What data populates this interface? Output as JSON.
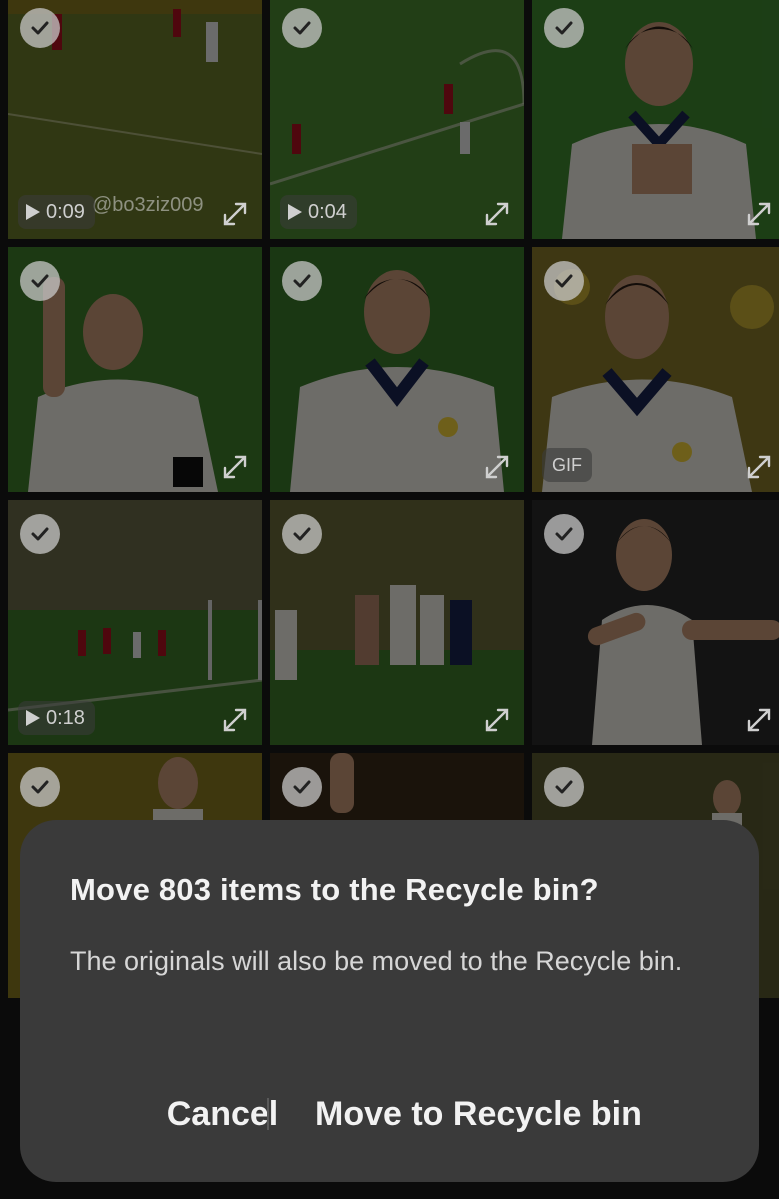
{
  "grid": {
    "tiles": [
      {
        "type": "video",
        "duration": "0:09",
        "watermark": "@bo3ziz009",
        "scene": "pitch-wide",
        "selected": true
      },
      {
        "type": "video",
        "duration": "0:04",
        "scene": "pitch-wide",
        "selected": true
      },
      {
        "type": "photo",
        "scene": "player-portrait",
        "selected": true
      },
      {
        "type": "photo",
        "scene": "player-portrait",
        "selected": true
      },
      {
        "type": "photo",
        "scene": "player-portrait",
        "selected": true
      },
      {
        "type": "gif",
        "badge": "GIF",
        "scene": "player-portrait",
        "selected": true
      },
      {
        "type": "video",
        "duration": "0:18",
        "scene": "stadium",
        "selected": true
      },
      {
        "type": "photo",
        "scene": "celebration",
        "selected": true
      },
      {
        "type": "photo",
        "scene": "player-portrait",
        "selected": true
      },
      {
        "type": "photo",
        "scene": "player-portrait",
        "selected": true
      },
      {
        "type": "photo",
        "scene": "player-portrait",
        "selected": true
      },
      {
        "type": "photo",
        "scene": "stadium",
        "selected": true
      }
    ]
  },
  "dialog": {
    "title": "Move 803 items to the Recycle bin?",
    "message": "The originals will also be moved to the Recycle bin.",
    "cancel_label": "Cancel",
    "confirm_label": "Move to Recycle bin"
  },
  "colors": {
    "dialog_bg": "#3a3a3a",
    "pitch_green": "#3f7a2c",
    "jersey_yellow": "#f3d23a",
    "jersey_navy": "#1a2450"
  }
}
